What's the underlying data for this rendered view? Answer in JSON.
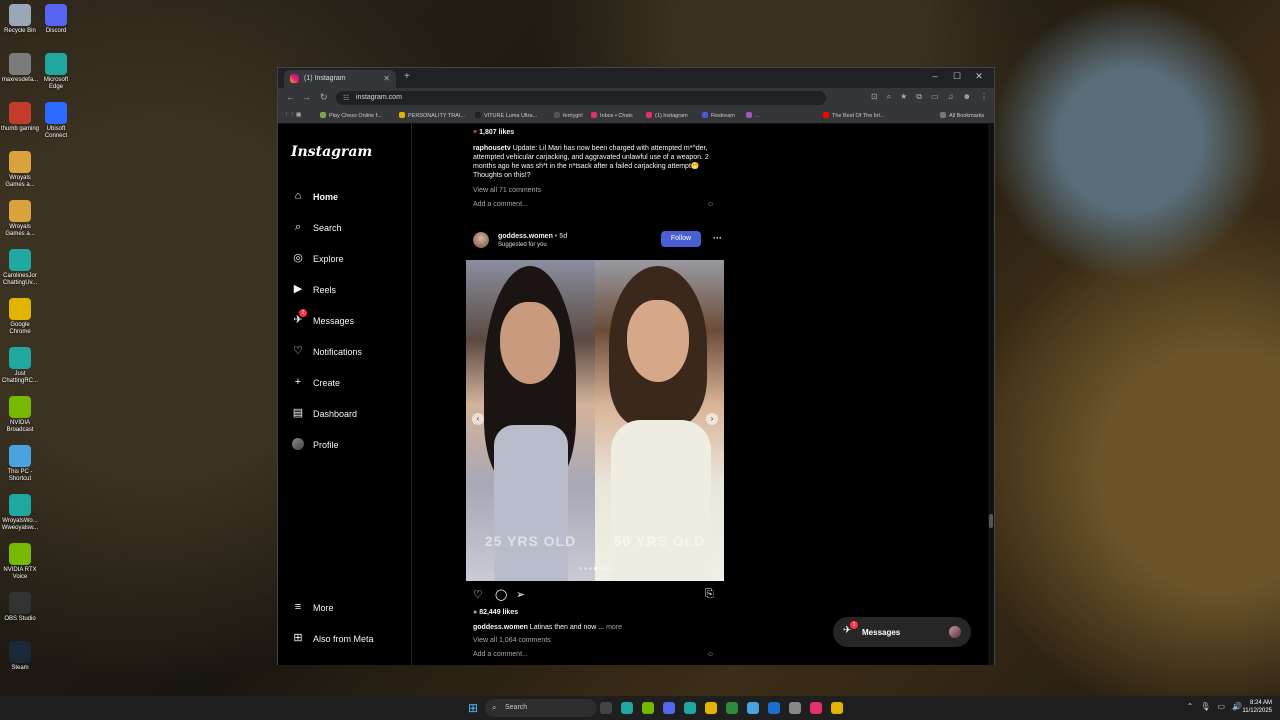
{
  "desktop": {
    "icons": [
      {
        "label": "Recycle Bin",
        "color": "#9aa7b8"
      },
      {
        "label": "Discord",
        "color": "#5865f2"
      },
      {
        "label": "maxresdefa...",
        "color": "#7b7b7b"
      },
      {
        "label": "Microsoft Edge",
        "color": "#1fa7a0"
      },
      {
        "label": "thumb gaming",
        "color": "#c23b2b"
      },
      {
        "label": "Ubisoft Connect",
        "color": "#2b6bff"
      },
      {
        "label": "Wroyals Games a...",
        "color": "#d9a23c"
      },
      {
        "label": "Wroyals Games a...",
        "color": "#d9a23c"
      },
      {
        "label": "CarolinesJor ChattingUv...",
        "color": "#1fa7a0"
      },
      {
        "label": "Google Chrome",
        "color": "#e0b400"
      },
      {
        "label": "Just ChattingRC...",
        "color": "#1fa7a0"
      },
      {
        "label": "NVIDIA Broadcast",
        "color": "#76b900"
      },
      {
        "label": "This PC - Shortcut",
        "color": "#4aa3df"
      },
      {
        "label": "WroyalsWo... Wweoyalsw...",
        "color": "#1fa7a0"
      },
      {
        "label": "NVIDIA RTX Voice",
        "color": "#76b900"
      },
      {
        "label": "OBS Studio",
        "color": "#333333"
      },
      {
        "label": "Steam",
        "color": "#1b2838"
      }
    ]
  },
  "browser": {
    "tab_title": "(1) Instagram",
    "tab_close": "✕",
    "new_tab": "+",
    "window_controls": [
      "–",
      "☐",
      "✕"
    ],
    "url": "instagram.com",
    "bookmarks": [
      {
        "label": "Play Chess Online f...",
        "color": "#7fa650"
      },
      {
        "label": "PERSONALITY TRAI...",
        "color": "#e0b400"
      },
      {
        "label": "VITURE Luma Ultra...",
        "color": "#222222"
      },
      {
        "label": "ferriygirl",
        "color": "#555555"
      },
      {
        "label": "Inbox • Chats",
        "color": "#e1306c"
      },
      {
        "label": "(1) Instagram",
        "color": "#e1306c"
      },
      {
        "label": "Restream",
        "color": "#4c5bd4"
      },
      {
        "label": "...",
        "color": "#9b59b6"
      },
      {
        "label": "The Best Of The Int...",
        "color": "#ff0000"
      },
      {
        "label": "All Bookmarks",
        "color": "#777777"
      }
    ]
  },
  "instagram": {
    "logo": "Instagram",
    "nav": [
      {
        "label": "Home",
        "icon": "home-icon",
        "glyph": "⌂"
      },
      {
        "label": "Search",
        "icon": "search-icon",
        "glyph": "⌕"
      },
      {
        "label": "Explore",
        "icon": "compass-icon",
        "glyph": "◎"
      },
      {
        "label": "Reels",
        "icon": "reels-icon",
        "glyph": "▶"
      },
      {
        "label": "Messages",
        "icon": "messenger-icon",
        "glyph": "✈",
        "badge": "1"
      },
      {
        "label": "Notifications",
        "icon": "heart-icon",
        "glyph": "♡"
      },
      {
        "label": "Create",
        "icon": "plus-icon",
        "glyph": "+"
      },
      {
        "label": "Dashboard",
        "icon": "dashboard-icon",
        "glyph": "▤"
      },
      {
        "label": "Profile",
        "icon": "profile-avatar",
        "glyph": ""
      }
    ],
    "more": {
      "label": "More",
      "glyph": "≡"
    },
    "meta": {
      "label": "Also from Meta",
      "glyph": "⊞"
    },
    "prev_post": {
      "likes": "1,807 likes",
      "username": "raphousetv",
      "caption": "Update: Lil Mari has now been charged with attempted m*^der, attempted vehicular carjacking, and aggravated unlawful use of a weapon. 2 months ago he was sh*t in the n*tsack after a failed carjacking attempt😬 Thoughts on this!?",
      "view_comments": "View all 71 comments",
      "add_comment": "Add a comment..."
    },
    "post": {
      "username": "goddess.women",
      "age": "• 5d",
      "suggested": "Suggested for you",
      "follow": "Follow",
      "left_label": "25 YRS OLD",
      "right_label": "50 YRS OLD",
      "likes": "82,449 likes",
      "caption_user": "goddess.women",
      "caption": "Latinas then and now ...",
      "more": "more",
      "view_comments": "View all 1,064 comments",
      "add_comment": "Add a comment..."
    },
    "messages_pill": {
      "label": "Messages",
      "badge": "1"
    }
  },
  "taskbar": {
    "search": "Search",
    "apps": [
      "#444444",
      "#1fa7a0",
      "#76b900",
      "#5865f2",
      "#1fa7a0",
      "#e0b400",
      "#2d8a3e",
      "#4aa3df",
      "#1b6fcf",
      "#888888",
      "#e1306c",
      "#e0b400"
    ],
    "time": "8:24 AM",
    "date": "11/12/2025"
  },
  "colors": {
    "follow_button": "#4a5fd4",
    "badge": "#ff3040"
  }
}
